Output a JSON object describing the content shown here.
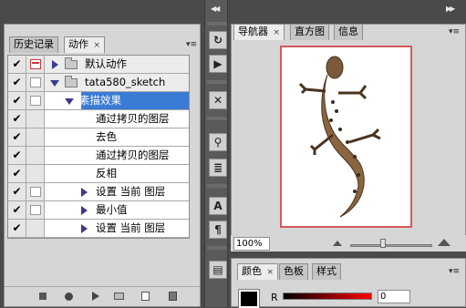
{
  "actions_panel": {
    "tabs": [
      {
        "label": "历史记录"
      },
      {
        "label": "动作",
        "close": "×"
      }
    ],
    "rows": [
      {
        "check": "✔",
        "label": "默认动作"
      },
      {
        "check": "✔",
        "label": "tata580_sketch"
      },
      {
        "check": "✔",
        "label": "素描效果"
      },
      {
        "check": "✔",
        "label": "通过拷贝的图层"
      },
      {
        "check": "✔",
        "label": "去色"
      },
      {
        "check": "✔",
        "label": "通过拷贝的图层"
      },
      {
        "check": "✔",
        "label": "反相"
      },
      {
        "check": "✔",
        "label": "设置 当前 图层"
      },
      {
        "check": "✔",
        "label": "最小值"
      },
      {
        "check": "✔",
        "label": "设置 当前 图层"
      }
    ],
    "toolbar_icons": [
      "stop-icon",
      "record-icon",
      "play-icon",
      "new-set-icon",
      "new-action-icon",
      "delete-icon"
    ]
  },
  "navigator_panel": {
    "tabs": [
      {
        "label": "导航器",
        "close": "×"
      },
      {
        "label": "直方图"
      },
      {
        "label": "信息"
      }
    ],
    "zoom": "100%"
  },
  "color_panel": {
    "tabs": [
      {
        "label": "颜色",
        "close": "×"
      },
      {
        "label": "色板"
      },
      {
        "label": "样式"
      }
    ],
    "channel_label": "R",
    "channel_value": "0"
  },
  "dock_icons": [
    "history-brush-icon",
    "actions-icon",
    "tools-icon",
    "clone-source-icon",
    "brushes-icon",
    "character-icon",
    "paragraph-icon",
    "layer-comps-icon"
  ],
  "colors": {
    "selection": "#3a7bd5",
    "preview_border": "#d65a5a"
  }
}
